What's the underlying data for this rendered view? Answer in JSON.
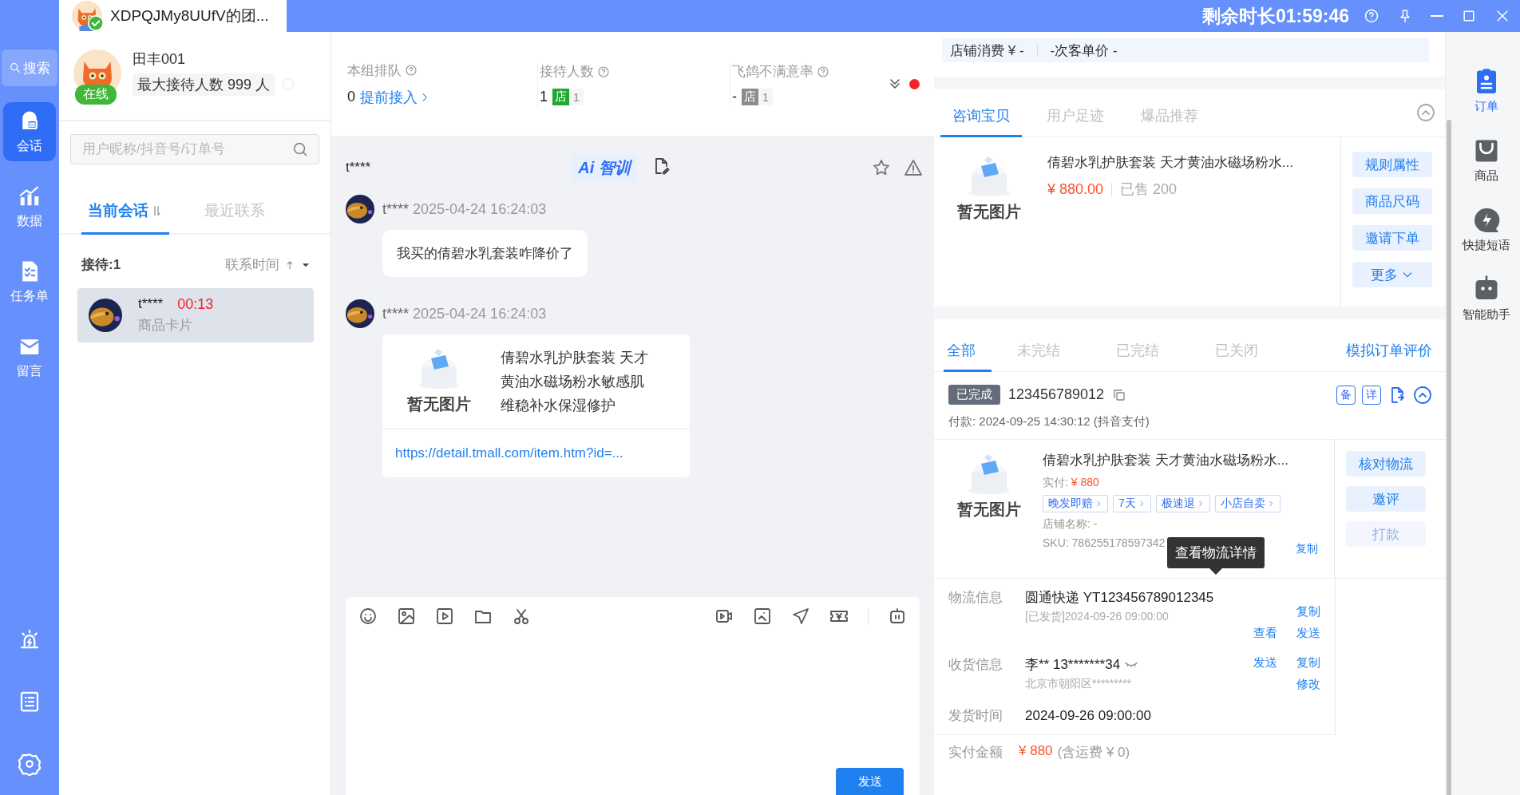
{
  "window": {
    "tab_title": "XDPQJMy8UUfV的团...",
    "remaining_time": "剩余时长01:59:46"
  },
  "nav": {
    "search": "搜索",
    "items": [
      {
        "label": "会话",
        "selected": true
      },
      {
        "label": "数据",
        "selected": false
      },
      {
        "label": "任务单",
        "selected": false
      },
      {
        "label": "留言",
        "selected": false
      }
    ]
  },
  "agent": {
    "name": "田丰001",
    "capacity": "最大接待人数 999 人",
    "status": "在线"
  },
  "conversation_search": {
    "placeholder": "用户昵称/抖音号/订单号"
  },
  "conversation_tabs": [
    {
      "label": "当前会话",
      "selected": true
    },
    {
      "label": "最近联系",
      "selected": false
    }
  ],
  "list_header": {
    "count": "接待:1",
    "sort": "联系时间"
  },
  "conversations": [
    {
      "name": "t****",
      "timer": "00:13",
      "preview": "商品卡片",
      "selected": true
    }
  ],
  "stats": [
    {
      "label": "本组排队",
      "value": "0",
      "link": "提前接入"
    },
    {
      "label": "接待人数",
      "value": "1",
      "tag": "店",
      "tag_count": "1",
      "color": "#1fa832"
    },
    {
      "label": "飞鸽不满意率",
      "value": "-",
      "tag": "店",
      "tag_count": "1",
      "color": "#8c8c8c"
    }
  ],
  "chat": {
    "title": "t****",
    "ai_label": "Ai 智训",
    "messages": [
      {
        "kind": "text",
        "sender": "t****",
        "time": "2025-04-24 16:24:03",
        "text": "我买的倩碧水乳套装咋降价了"
      },
      {
        "kind": "product",
        "sender": "t****",
        "time": "2025-04-24 16:24:03",
        "image_label": "暂无图片",
        "title": "倩碧水乳护肤套装 天才黄油水磁场粉水敏感肌维稳补水保湿修护",
        "link": "https://detail.tmall.com/item.htm?id=..."
      }
    ]
  },
  "composer": {
    "send": "发送"
  },
  "shop_stats": [
    "店铺消费 ¥ -",
    "-次客单价 -"
  ],
  "product_tabs": [
    {
      "label": "咨询宝贝",
      "selected": true
    },
    {
      "label": "用户足迹",
      "selected": false
    },
    {
      "label": "爆品推荐",
      "selected": false
    }
  ],
  "product": {
    "image_label": "暂无图片",
    "title": "倩碧水乳护肤套装 天才黄油水磁场粉水...",
    "price": "¥ 880.00",
    "sold": "已售 200"
  },
  "product_actions": [
    {
      "label": "规则属性",
      "kind": "plain"
    },
    {
      "label": "商品尺码",
      "kind": "plain"
    },
    {
      "label": "邀请下单",
      "kind": "plain"
    },
    {
      "label": "更多",
      "kind": "dropdown"
    }
  ],
  "order_tabs": [
    {
      "label": "全部",
      "selected": true
    },
    {
      "label": "未完结",
      "selected": false
    },
    {
      "label": "已完结",
      "selected": false
    },
    {
      "label": "已关闭",
      "selected": false
    }
  ],
  "order_link": "模拟订单评价",
  "order": {
    "status": "已完成",
    "number": "123456789012",
    "badges": [
      "备",
      "详"
    ],
    "payment": "付款: 2024-09-25 14:30:12 (抖音支付)",
    "item": {
      "image_label": "暂无图片",
      "title": "倩碧水乳护肤套装 天才黄油水磁场粉水...",
      "paid_label": "实付:",
      "paid": "¥ 880",
      "tags": [
        "晚发即赔",
        "7天",
        "极速退",
        "小店自卖"
      ],
      "shop": "店铺名称: -",
      "sku": "SKU: 786255178597342",
      "copy": "复制"
    },
    "actions": [
      {
        "label": "核对物流",
        "disabled": false
      },
      {
        "label": "邀评",
        "disabled": false
      },
      {
        "label": "打款",
        "disabled": true
      }
    ],
    "tooltip": "查看物流详情",
    "logistics": {
      "label": "物流信息",
      "value": "圆通快递 YT123456789012345",
      "sub": "[已发货]2024-09-26 09:00:00",
      "links": [
        "复制",
        "查看",
        "发送"
      ]
    },
    "receiver": {
      "label": "收货信息",
      "value": "李** 13*******34",
      "sub": "北京市朝阳区*********",
      "links": [
        "发送",
        "复制",
        "修改"
      ]
    },
    "ship_time": {
      "label": "发货时间",
      "value": "2024-09-26 09:00:00"
    },
    "total": {
      "label": "实付金额",
      "amount": "¥ 880",
      "note": "(含运费 ¥ 0)"
    }
  },
  "right_rail": [
    {
      "label": "订单",
      "selected": true
    },
    {
      "label": "商品",
      "selected": false
    },
    {
      "label": "快捷短语",
      "selected": false
    },
    {
      "label": "智能助手",
      "selected": false
    }
  ]
}
